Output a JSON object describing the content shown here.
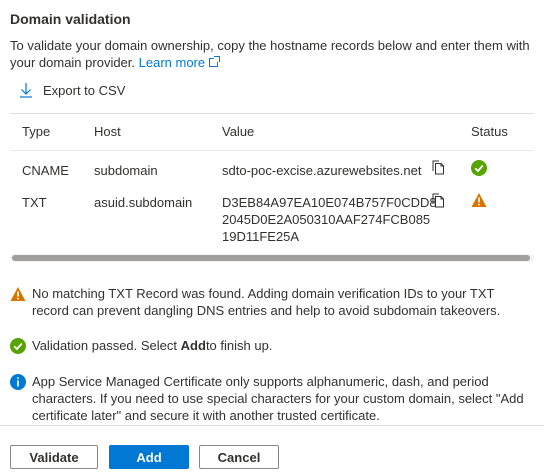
{
  "header": {
    "title": "Domain validation",
    "description": "To validate your domain ownership, copy the hostname records below and enter them with your domain provider.",
    "learn_more": "Learn more"
  },
  "toolbar": {
    "export_label": "Export to CSV"
  },
  "table": {
    "columns": [
      "Type",
      "Host",
      "Value",
      "Status"
    ],
    "rows": [
      {
        "type": "CNAME",
        "host": "subdomain",
        "value": "sdto-poc-excise.azurewebsites.net",
        "status": "success"
      },
      {
        "type": "TXT",
        "host": "asuid.subdomain",
        "value_lines": [
          "D3EB84A97EA10E074B757F0CDD8",
          "2045D0E2A050310AAF274FCB085",
          "19D11FE25A"
        ],
        "status": "warning"
      }
    ]
  },
  "messages": {
    "warning": "No matching TXT Record was found. Adding domain verification IDs to your TXT record can prevent dangling DNS entries and help to avoid subdomain takeovers.",
    "success_prefix": "Validation passed. Select",
    "success_bold": "Add",
    "success_suffix": "to finish up.",
    "info": "App Service Managed Certificate only supports alphanumeric, dash, and period characters. If you need to use special characters for your custom domain, select \"Add certificate later\" and secure it with another trusted certificate."
  },
  "footer": {
    "validate_label": "Validate",
    "add_label": "Add",
    "cancel_label": "Cancel"
  },
  "icons": {
    "export": "download-icon",
    "copy": "copy-icon",
    "success": "checkmark-circle-icon",
    "warning": "warning-triangle-icon",
    "info": "info-circle-icon"
  },
  "colors": {
    "accent": "#0078d4",
    "success": "#57a300",
    "warning": "#d47500",
    "info": "#0078d4"
  }
}
